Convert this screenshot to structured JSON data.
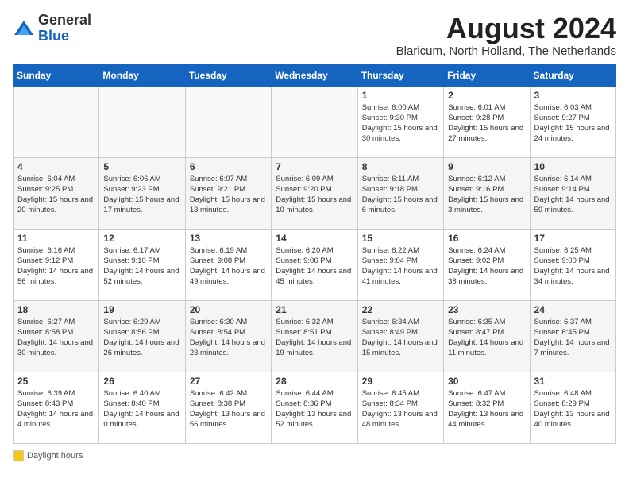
{
  "header": {
    "logo_general": "General",
    "logo_blue": "Blue",
    "month_year": "August 2024",
    "location": "Blaricum, North Holland, The Netherlands"
  },
  "weekdays": [
    "Sunday",
    "Monday",
    "Tuesday",
    "Wednesday",
    "Thursday",
    "Friday",
    "Saturday"
  ],
  "weeks": [
    [
      {
        "day": "",
        "info": ""
      },
      {
        "day": "",
        "info": ""
      },
      {
        "day": "",
        "info": ""
      },
      {
        "day": "",
        "info": ""
      },
      {
        "day": "1",
        "sunrise": "Sunrise: 6:00 AM",
        "sunset": "Sunset: 9:30 PM",
        "daylight": "Daylight: 15 hours and 30 minutes."
      },
      {
        "day": "2",
        "sunrise": "Sunrise: 6:01 AM",
        "sunset": "Sunset: 9:28 PM",
        "daylight": "Daylight: 15 hours and 27 minutes."
      },
      {
        "day": "3",
        "sunrise": "Sunrise: 6:03 AM",
        "sunset": "Sunset: 9:27 PM",
        "daylight": "Daylight: 15 hours and 24 minutes."
      }
    ],
    [
      {
        "day": "4",
        "sunrise": "Sunrise: 6:04 AM",
        "sunset": "Sunset: 9:25 PM",
        "daylight": "Daylight: 15 hours and 20 minutes."
      },
      {
        "day": "5",
        "sunrise": "Sunrise: 6:06 AM",
        "sunset": "Sunset: 9:23 PM",
        "daylight": "Daylight: 15 hours and 17 minutes."
      },
      {
        "day": "6",
        "sunrise": "Sunrise: 6:07 AM",
        "sunset": "Sunset: 9:21 PM",
        "daylight": "Daylight: 15 hours and 13 minutes."
      },
      {
        "day": "7",
        "sunrise": "Sunrise: 6:09 AM",
        "sunset": "Sunset: 9:20 PM",
        "daylight": "Daylight: 15 hours and 10 minutes."
      },
      {
        "day": "8",
        "sunrise": "Sunrise: 6:11 AM",
        "sunset": "Sunset: 9:18 PM",
        "daylight": "Daylight: 15 hours and 6 minutes."
      },
      {
        "day": "9",
        "sunrise": "Sunrise: 6:12 AM",
        "sunset": "Sunset: 9:16 PM",
        "daylight": "Daylight: 15 hours and 3 minutes."
      },
      {
        "day": "10",
        "sunrise": "Sunrise: 6:14 AM",
        "sunset": "Sunset: 9:14 PM",
        "daylight": "Daylight: 14 hours and 59 minutes."
      }
    ],
    [
      {
        "day": "11",
        "sunrise": "Sunrise: 6:16 AM",
        "sunset": "Sunset: 9:12 PM",
        "daylight": "Daylight: 14 hours and 56 minutes."
      },
      {
        "day": "12",
        "sunrise": "Sunrise: 6:17 AM",
        "sunset": "Sunset: 9:10 PM",
        "daylight": "Daylight: 14 hours and 52 minutes."
      },
      {
        "day": "13",
        "sunrise": "Sunrise: 6:19 AM",
        "sunset": "Sunset: 9:08 PM",
        "daylight": "Daylight: 14 hours and 49 minutes."
      },
      {
        "day": "14",
        "sunrise": "Sunrise: 6:20 AM",
        "sunset": "Sunset: 9:06 PM",
        "daylight": "Daylight: 14 hours and 45 minutes."
      },
      {
        "day": "15",
        "sunrise": "Sunrise: 6:22 AM",
        "sunset": "Sunset: 9:04 PM",
        "daylight": "Daylight: 14 hours and 41 minutes."
      },
      {
        "day": "16",
        "sunrise": "Sunrise: 6:24 AM",
        "sunset": "Sunset: 9:02 PM",
        "daylight": "Daylight: 14 hours and 38 minutes."
      },
      {
        "day": "17",
        "sunrise": "Sunrise: 6:25 AM",
        "sunset": "Sunset: 9:00 PM",
        "daylight": "Daylight: 14 hours and 34 minutes."
      }
    ],
    [
      {
        "day": "18",
        "sunrise": "Sunrise: 6:27 AM",
        "sunset": "Sunset: 8:58 PM",
        "daylight": "Daylight: 14 hours and 30 minutes."
      },
      {
        "day": "19",
        "sunrise": "Sunrise: 6:29 AM",
        "sunset": "Sunset: 8:56 PM",
        "daylight": "Daylight: 14 hours and 26 minutes."
      },
      {
        "day": "20",
        "sunrise": "Sunrise: 6:30 AM",
        "sunset": "Sunset: 8:54 PM",
        "daylight": "Daylight: 14 hours and 23 minutes."
      },
      {
        "day": "21",
        "sunrise": "Sunrise: 6:32 AM",
        "sunset": "Sunset: 8:51 PM",
        "daylight": "Daylight: 14 hours and 19 minutes."
      },
      {
        "day": "22",
        "sunrise": "Sunrise: 6:34 AM",
        "sunset": "Sunset: 8:49 PM",
        "daylight": "Daylight: 14 hours and 15 minutes."
      },
      {
        "day": "23",
        "sunrise": "Sunrise: 6:35 AM",
        "sunset": "Sunset: 8:47 PM",
        "daylight": "Daylight: 14 hours and 11 minutes."
      },
      {
        "day": "24",
        "sunrise": "Sunrise: 6:37 AM",
        "sunset": "Sunset: 8:45 PM",
        "daylight": "Daylight: 14 hours and 7 minutes."
      }
    ],
    [
      {
        "day": "25",
        "sunrise": "Sunrise: 6:39 AM",
        "sunset": "Sunset: 8:43 PM",
        "daylight": "Daylight: 14 hours and 4 minutes."
      },
      {
        "day": "26",
        "sunrise": "Sunrise: 6:40 AM",
        "sunset": "Sunset: 8:40 PM",
        "daylight": "Daylight: 14 hours and 0 minutes."
      },
      {
        "day": "27",
        "sunrise": "Sunrise: 6:42 AM",
        "sunset": "Sunset: 8:38 PM",
        "daylight": "Daylight: 13 hours and 56 minutes."
      },
      {
        "day": "28",
        "sunrise": "Sunrise: 6:44 AM",
        "sunset": "Sunset: 8:36 PM",
        "daylight": "Daylight: 13 hours and 52 minutes."
      },
      {
        "day": "29",
        "sunrise": "Sunrise: 6:45 AM",
        "sunset": "Sunset: 8:34 PM",
        "daylight": "Daylight: 13 hours and 48 minutes."
      },
      {
        "day": "30",
        "sunrise": "Sunrise: 6:47 AM",
        "sunset": "Sunset: 8:32 PM",
        "daylight": "Daylight: 13 hours and 44 minutes."
      },
      {
        "day": "31",
        "sunrise": "Sunrise: 6:48 AM",
        "sunset": "Sunset: 8:29 PM",
        "daylight": "Daylight: 13 hours and 40 minutes."
      }
    ]
  ],
  "legend": {
    "daylight_label": "Daylight hours"
  }
}
